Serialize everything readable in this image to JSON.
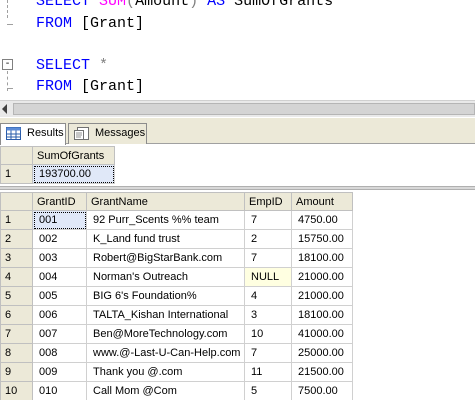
{
  "editor": {
    "line1": {
      "kw1": "SELECT",
      "fn": "SUM",
      "p1": "(",
      "col": "Amount",
      "p2": ")",
      "kw2": "AS",
      "alias": "SumOfGrants"
    },
    "line2": {
      "kw": "FROM",
      "table": "[Grant]"
    },
    "line4": {
      "kw": "SELECT",
      "star": "*"
    },
    "line5": {
      "kw": "FROM",
      "table": "[Grant]"
    },
    "outline_collapse": "-"
  },
  "tabs": [
    {
      "label": "Results",
      "icon": "grid-icon",
      "active": true
    },
    {
      "label": "Messages",
      "icon": "messages-icon",
      "active": false
    }
  ],
  "grid1": {
    "header": "SumOfGrants",
    "rows": [
      {
        "num": "1",
        "value": "193700.00"
      }
    ]
  },
  "grid2": {
    "headers": [
      "GrantID",
      "GrantName",
      "EmpID",
      "Amount"
    ],
    "rows": [
      {
        "num": "1",
        "id": "001",
        "name": "92 Purr_Scents %% team",
        "emp": "7",
        "amount": "4750.00"
      },
      {
        "num": "2",
        "id": "002",
        "name": "K_Land fund trust",
        "emp": "2",
        "amount": "15750.00"
      },
      {
        "num": "3",
        "id": "003",
        "name": "Robert@BigStarBank.com",
        "emp": "7",
        "amount": "18100.00"
      },
      {
        "num": "4",
        "id": "004",
        "name": "Norman's Outreach",
        "emp": "NULL",
        "amount": "21000.00"
      },
      {
        "num": "5",
        "id": "005",
        "name": "BIG 6's Foundation%",
        "emp": "4",
        "amount": "21000.00"
      },
      {
        "num": "6",
        "id": "006",
        "name": "TALTA_Kishan International",
        "emp": "3",
        "amount": "18100.00"
      },
      {
        "num": "7",
        "id": "007",
        "name": "Ben@MoreTechnology.com",
        "emp": "10",
        "amount": "41000.00"
      },
      {
        "num": "8",
        "id": "008",
        "name": "www.@-Last-U-Can-Help.com",
        "emp": "7",
        "amount": "25000.00"
      },
      {
        "num": "9",
        "id": "009",
        "name": "Thank you @.com",
        "emp": "11",
        "amount": "21500.00"
      },
      {
        "num": "10",
        "id": "010",
        "name": "Call Mom @Com",
        "emp": "5",
        "amount": "7500.00"
      }
    ]
  },
  "colors": {
    "keyword": "#0000ff",
    "function": "#ff00ff",
    "null_bg": "#ffffe1",
    "header_bg": "#ece9d8"
  }
}
